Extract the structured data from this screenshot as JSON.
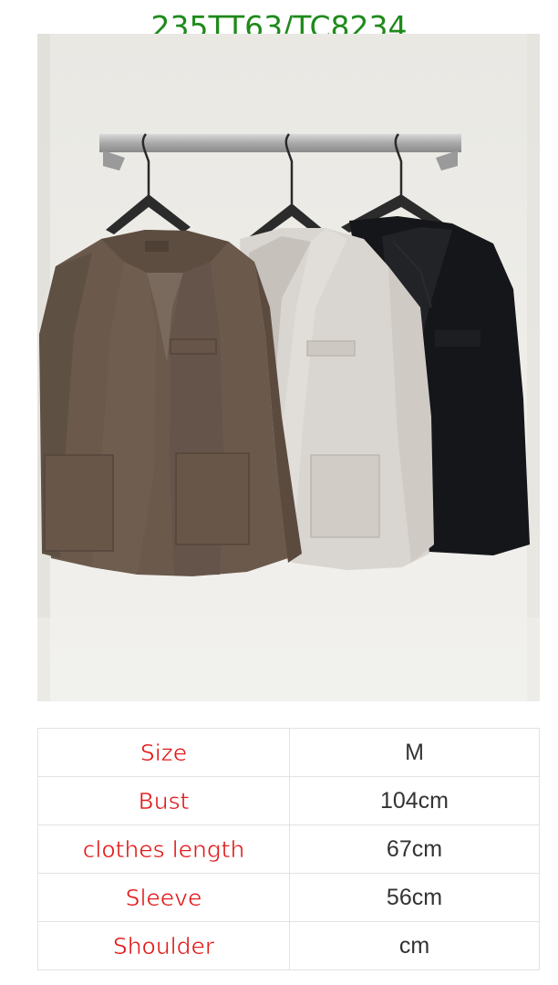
{
  "product_code": "235TT63/TC8234",
  "photo": {
    "subject": "three-jackets-on-hangers",
    "jacket_colors": [
      "#6b5a4c",
      "#d9d5d0",
      "#15161a"
    ],
    "wall_color": "#ecebe7"
  },
  "size_table": [
    {
      "label": "Size",
      "value": "M"
    },
    {
      "label": "Bust",
      "value": "104cm"
    },
    {
      "label": "clothes length",
      "value": "67cm"
    },
    {
      "label": "Sleeve",
      "value": "56cm"
    },
    {
      "label": "Shoulder",
      "value": "cm"
    }
  ]
}
